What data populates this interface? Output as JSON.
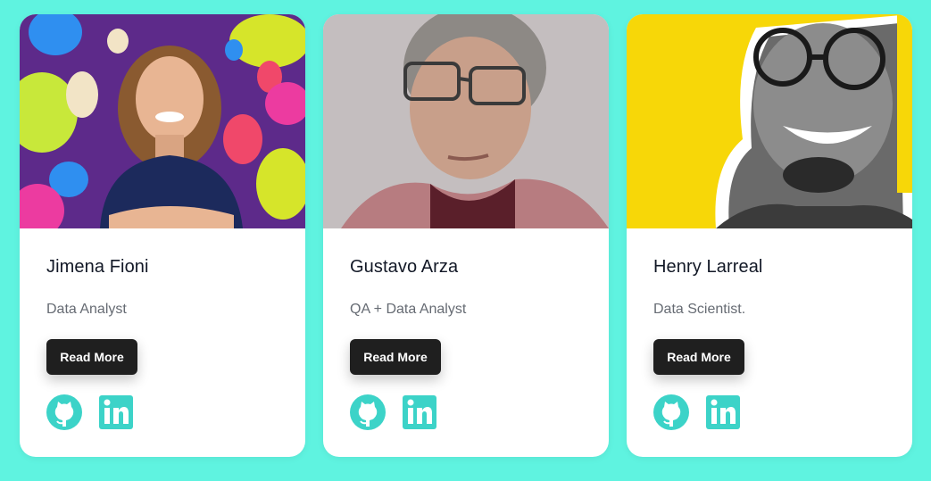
{
  "colors": {
    "background": "#5ff3e0",
    "card": "#ffffff",
    "button": "#1f1f1f",
    "icon_accent": "#3cd3c8",
    "photo1_bg": "#5d2a8a",
    "photo3_bg": "#f7d708"
  },
  "cards": [
    {
      "name": "Jimena Fioni",
      "role": "Data Analyst",
      "button_label": "Read More",
      "icons": [
        "github-icon",
        "linkedin-icon"
      ]
    },
    {
      "name": "Gustavo Arza",
      "role": "QA + Data Analyst",
      "button_label": "Read More",
      "icons": [
        "github-icon",
        "linkedin-icon"
      ]
    },
    {
      "name": "Henry Larreal",
      "role": "Data Scientist.",
      "button_label": "Read More",
      "icons": [
        "github-icon",
        "linkedin-icon"
      ]
    }
  ]
}
